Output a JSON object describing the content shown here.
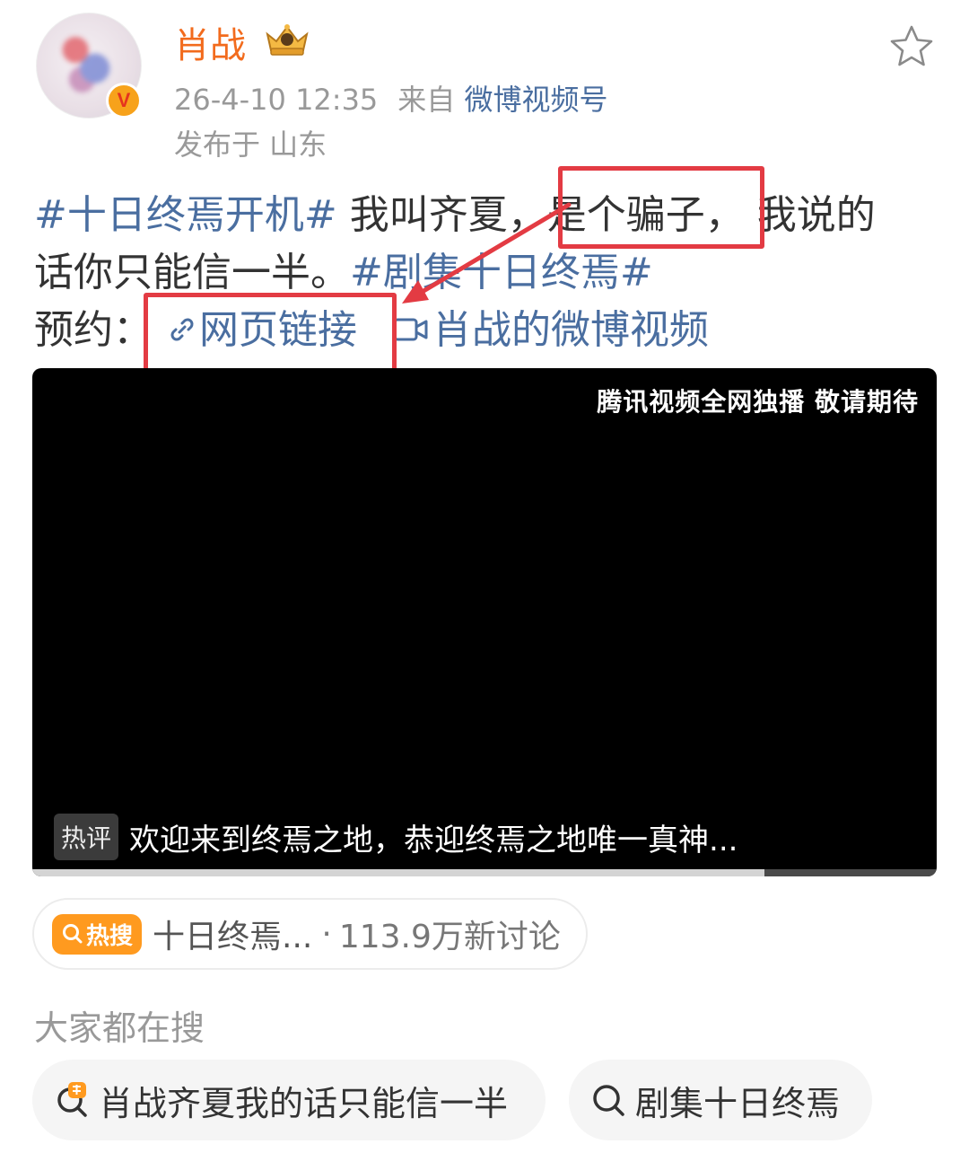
{
  "post": {
    "author": "肖战",
    "verified_badge": "V",
    "date": "26-4-10 12:35",
    "source_prefix": "来自",
    "source": "微博视频号",
    "location": "发布于 山东",
    "text": {
      "tag1": "#十日终焉开机#",
      "part1": " 我叫齐夏，",
      "part2": "是个骗子，",
      "part3": " 我说的",
      "part4": "话你只能信一半。",
      "tag2": "#剧集十日终焉#",
      "reserve_label": "预约：",
      "web_link": "网页链接",
      "video_link": "肖战的微博视频"
    }
  },
  "video": {
    "watermark": "腾讯视频全网独播 敬请期待",
    "hot_comment_label": "热评",
    "hot_comment": "欢迎来到终焉之地，恭迎终焉之地唯一真神...",
    "progress": 0.81
  },
  "hot_search": {
    "badge": "热搜",
    "topic": "十日终焉...",
    "separator": "·",
    "count": "113.9万新讨论"
  },
  "related": {
    "title": "大家都在搜",
    "items": [
      {
        "label": "肖战齐夏我的话只能信一半",
        "icon": "hot-search-icon"
      },
      {
        "label": "剧集十日终焉",
        "icon": "search-icon"
      }
    ]
  },
  "colors": {
    "username": "#f26b1d",
    "link": "#4a6ea0",
    "annotation_red": "#e33b43",
    "hot_badge": "#ff9a1f"
  }
}
